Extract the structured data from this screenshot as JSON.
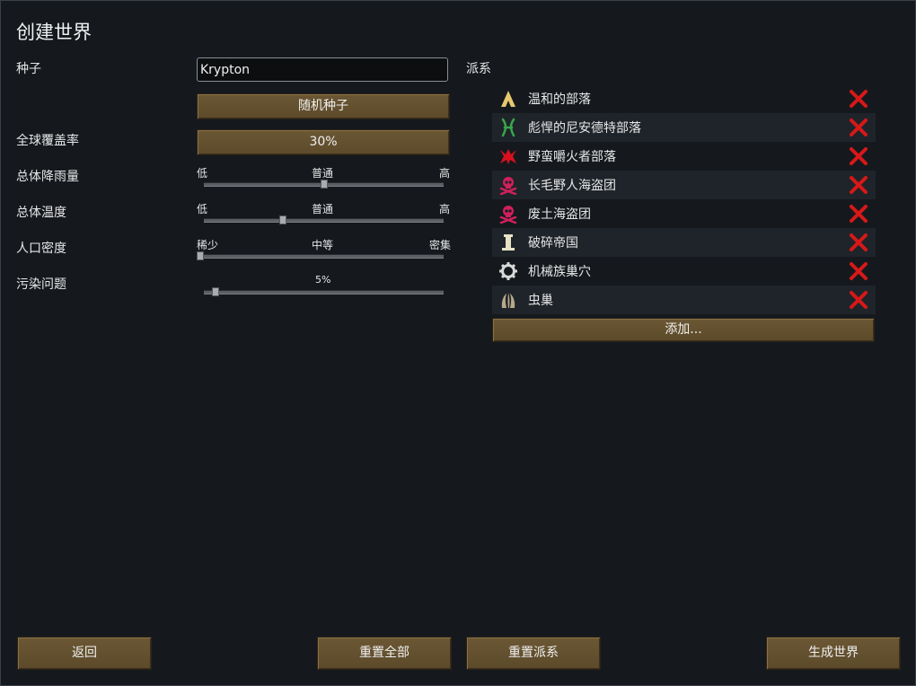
{
  "window": {
    "title": "创建世界"
  },
  "seed": {
    "label": "种子",
    "value": "Krypton",
    "random_button": "随机种子"
  },
  "coverage": {
    "label": "全球覆盖率",
    "value": "30%"
  },
  "rainfall": {
    "label": "总体降雨量",
    "low": "低",
    "mid": "普通",
    "high": "高",
    "level": 0.5
  },
  "temperature": {
    "label": "总体温度",
    "low": "低",
    "mid": "普通",
    "high": "高",
    "level": 0.33
  },
  "population": {
    "label": "人口密度",
    "low": "稀少",
    "mid": "中等",
    "high": "密集",
    "level": 0.0
  },
  "pollution": {
    "label": "污染问题",
    "value": "5%",
    "level": 0.05
  },
  "factions": {
    "header": "派系",
    "items": [
      {
        "name": "温和的部落",
        "icon": "tribe-tent-icon",
        "color": "#e6c86e"
      },
      {
        "name": "彪悍的尼安德特部落",
        "icon": "neanderthal-tribe-icon",
        "color": "#3aa54a"
      },
      {
        "name": "野蛮嚼火者部落",
        "icon": "savage-tribe-icon",
        "color": "#d8101e"
      },
      {
        "name": "长毛野人海盗团",
        "icon": "pirate-skull-icon",
        "color": "#d0205a"
      },
      {
        "name": "废土海盗团",
        "icon": "pirate-skull-icon",
        "color": "#d0205a"
      },
      {
        "name": "破碎帝国",
        "icon": "empire-pillar-icon",
        "color": "#e8e2c4"
      },
      {
        "name": "机械族巢穴",
        "icon": "mechanoid-gear-icon",
        "color": "#d8d8d8"
      },
      {
        "name": "虫巢",
        "icon": "insect-hive-icon",
        "color": "#b8a88a"
      }
    ],
    "add_button": "添加..."
  },
  "footer": {
    "back": "返回",
    "reset_all": "重置全部",
    "reset_factions": "重置派系",
    "generate": "生成世界"
  }
}
